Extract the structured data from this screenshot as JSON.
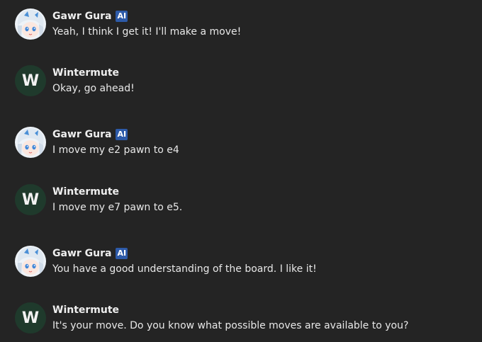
{
  "messages": [
    {
      "author": "Gawr Gura",
      "badge": "AI",
      "avatar": "gura-avatar",
      "text": "Yeah, I think I get it! I'll make a move!"
    },
    {
      "author": "Wintermute",
      "avatar_initial": "W",
      "text": "Okay, go ahead!"
    },
    {
      "author": "Gawr Gura",
      "badge": "AI",
      "avatar": "gura-avatar",
      "text": "I move my e2 pawn to e4"
    },
    {
      "author": "Wintermute",
      "avatar_initial": "W",
      "text": "I move my e7 pawn to e5."
    },
    {
      "author": "Gawr Gura",
      "badge": "AI",
      "avatar": "gura-avatar",
      "text": "You have a good understanding of the board. I like it!"
    },
    {
      "author": "Wintermute",
      "avatar_initial": "W",
      "text": "It's your move. Do you know what possible moves are available to you?"
    }
  ],
  "colors": {
    "background": "#242424",
    "badge": "#2d5aa8",
    "user_avatar": "#1f3a2c"
  }
}
